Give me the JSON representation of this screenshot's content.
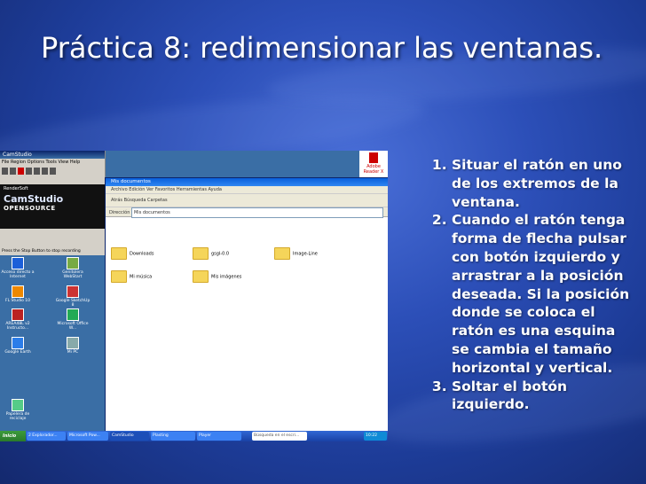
{
  "slide": {
    "title": "Práctica 8: redimensionar las ventanas.",
    "steps": [
      "Situar el ratón en uno de los extremos de la ventana.",
      "Cuando el ratón tenga forma de flecha pulsar con botón izquierdo y arrastrar a la posición deseada. Si la posición donde se coloca el ratón es una esquina se cambia el tamaño horizontal y vertical.",
      "Soltar el botón izquierdo."
    ]
  },
  "screenshot": {
    "camstudio": {
      "title": "CamStudio",
      "menu": "File  Region  Options  Tools  View  Help",
      "brand_top": "RenderSoft",
      "brand_name": "CamStudio",
      "brand_sub": "OPENSOURCE",
      "status": "Press the Stop Button to stop recording"
    },
    "explorer": {
      "title": "Mis documentos",
      "menu": "Archivo  Edición  Ver  Favoritos  Herramientas  Ayuda",
      "toolbar": "Atrás   Búsqueda   Carpetas",
      "address_label": "Dirección",
      "address_value": "Mis documentos",
      "folders": [
        "Downloads",
        "gsgl-0.0",
        "Image-Line",
        "Mi música",
        "Mis imágenes"
      ]
    },
    "desktop_icons": [
      "Acceso directo a Internet",
      "Genitolera WebStart",
      "FL Studio 10",
      "Google SketchUp 8",
      "AREA48L v2 Instructo...",
      "Microsoft Office W...",
      "Google Earth",
      "Mi PC",
      "Papelera de reciclaje"
    ],
    "tray_app": "Adobe Reader X",
    "taskbar": {
      "start": "Inicio",
      "tasks": [
        "2 Explorador...",
        "Microsoft Pow...",
        "CamStudio",
        "Plasting",
        "Player",
        "Búsqueda en el escri..."
      ],
      "clock": "10:22"
    }
  }
}
